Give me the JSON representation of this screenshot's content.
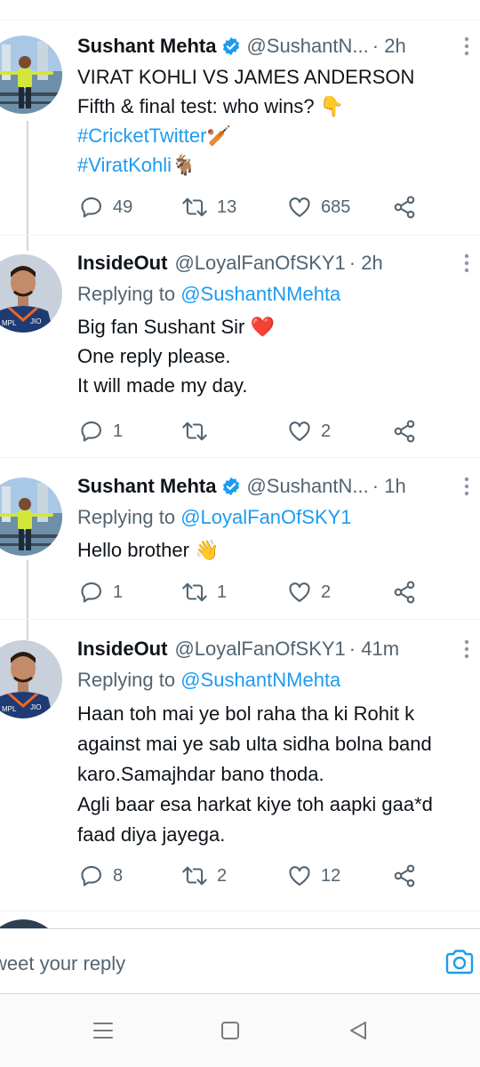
{
  "tweets": [
    {
      "name": "Sushant Mehta",
      "verified": true,
      "handle": "@SushantN...",
      "time": "· 2h",
      "lines": [
        {
          "text": "VIRAT KOHLI VS JAMES ANDERSON",
          "emoji": ""
        },
        {
          "text": "Fifth & final test: who wins?",
          "emoji": "👇"
        },
        {
          "text": "#CricketTwitter",
          "emoji": "🏏"
        },
        {
          "text": "#ViratKohli",
          "emoji": "🐐"
        }
      ],
      "replies": "49",
      "retweets": "13",
      "likes": "685"
    },
    {
      "name": "InsideOut",
      "verified": false,
      "handle": "@LoyalFanOfSKY1",
      "time": "· 2h",
      "replying_prefix": "Replying to",
      "replying_to": "@SushantNMehta",
      "lines": [
        {
          "text": "Big fan Sushant Sir",
          "emoji": "❤️"
        },
        {
          "text": "One reply please.",
          "emoji": ""
        },
        {
          "text": "It will made my day.",
          "emoji": ""
        }
      ],
      "replies": "1",
      "retweets": "",
      "likes": "2"
    },
    {
      "name": "Sushant Mehta",
      "verified": true,
      "handle": "@SushantN...",
      "time": "· 1h",
      "replying_prefix": "Replying to",
      "replying_to": "@LoyalFanOfSKY1",
      "lines": [
        {
          "text": "Hello brother",
          "emoji": "👋"
        }
      ],
      "replies": "1",
      "retweets": "1",
      "likes": "2"
    },
    {
      "name": "InsideOut",
      "verified": false,
      "handle": "@LoyalFanOfSKY1",
      "time": "· 41m",
      "replying_prefix": "Replying to",
      "replying_to": "@SushantNMehta",
      "lines": [
        {
          "text": "Haan toh mai ye bol raha tha ki Rohit k",
          "emoji": ""
        },
        {
          "text": "against mai ye sab ulta sidha bolna band",
          "emoji": ""
        },
        {
          "text": "karo.Samajhdar bano thoda.",
          "emoji": ""
        },
        {
          "text": "Agli baar esa harkat kiye toh aapki gaa*d",
          "emoji": ""
        },
        {
          "text": "faad diya jayega.",
          "emoji": ""
        }
      ],
      "replies": "8",
      "retweets": "2",
      "likes": "12"
    }
  ],
  "composer": {
    "placeholder": "weet your reply",
    "camera_icon": "camera-icon"
  },
  "navbar": {
    "icons": [
      "menu-icon",
      "home-square-icon",
      "back-triangle-icon"
    ]
  },
  "colors": {
    "accent": "#1d9bf0",
    "secondary_text": "#536471",
    "like_heart": "#e0245e"
  }
}
